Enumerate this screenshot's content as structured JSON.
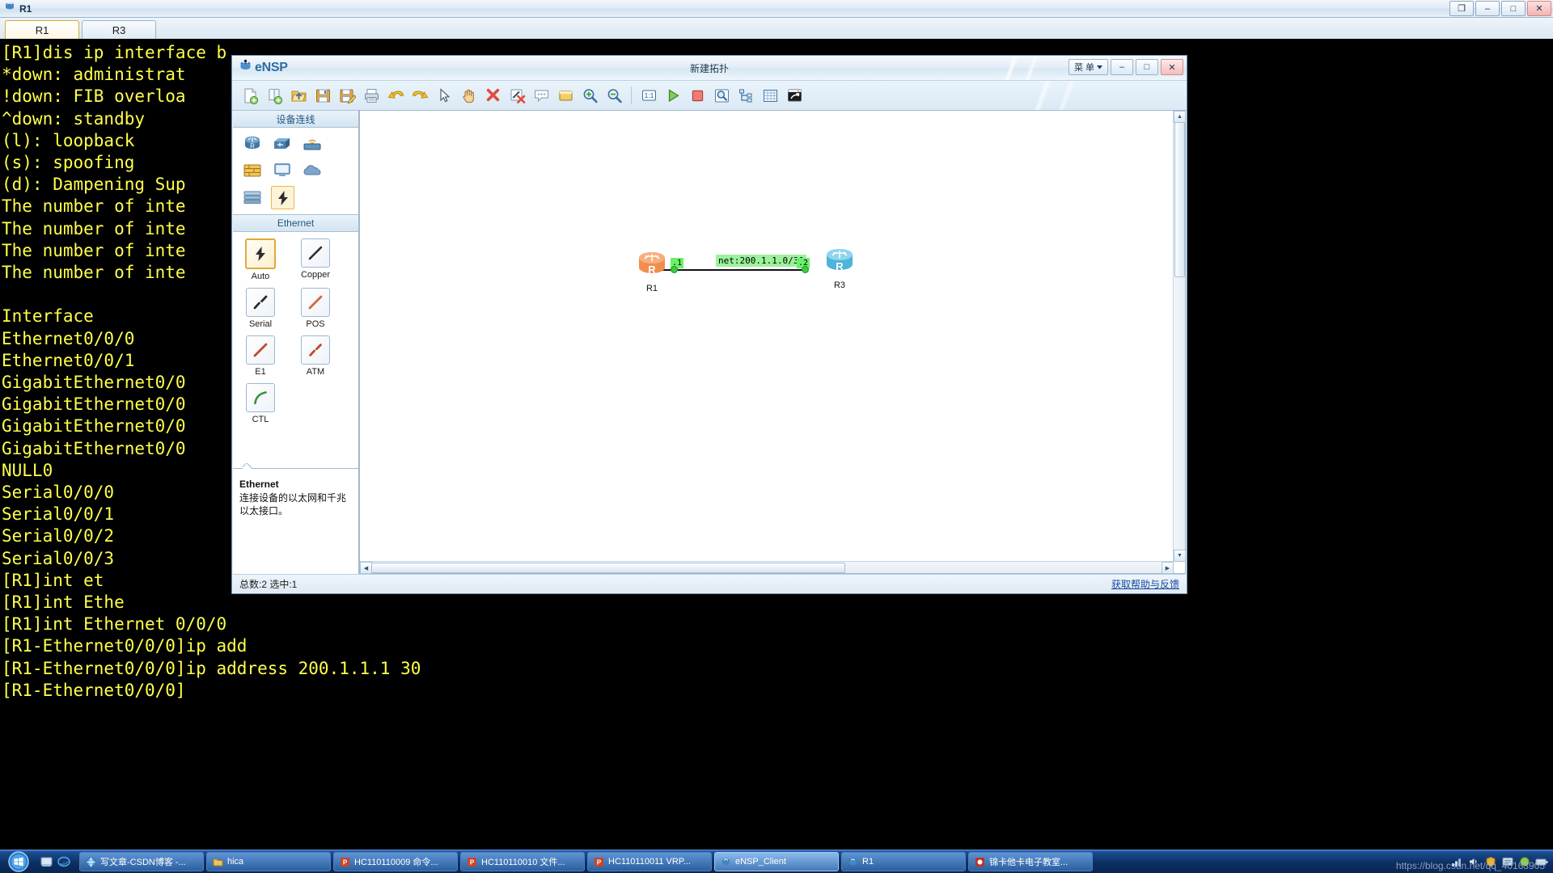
{
  "terminal": {
    "window_title": "R1",
    "icon": "ensp-device-icon",
    "window_buttons": [
      {
        "name": "restore-down",
        "glyph": "❐"
      },
      {
        "name": "minimize",
        "glyph": "–"
      },
      {
        "name": "maximize",
        "glyph": "□"
      },
      {
        "name": "close",
        "glyph": "✕"
      }
    ],
    "tabs": [
      {
        "label": "R1",
        "active": true
      },
      {
        "label": "R3",
        "active": false
      }
    ],
    "console_text": "[R1]dis ip interface b\n*down: administrat\n!down: FIB overloa\n^down: standby\n(l): loopback\n(s): spoofing\n(d): Dampening Sup\nThe number of inte\nThe number of inte\nThe number of inte\nThe number of inte\n\nInterface\nEthernet0/0/0\nEthernet0/0/1\nGigabitEthernet0/0\nGigabitEthernet0/0\nGigabitEthernet0/0\nGigabitEthernet0/0\nNULL0\nSerial0/0/0\nSerial0/0/1\nSerial0/0/2\nSerial0/0/3\n[R1]int et\n[R1]int Ethe\n[R1]int Ethernet 0/0/0\n[R1-Ethernet0/0/0]ip add\n[R1-Ethernet0/0/0]ip address 200.1.1.1 30\n[R1-Ethernet0/0/0]",
    "fg_color": "#ffff4d",
    "bg_color": "#000000"
  },
  "ensp": {
    "app_name": "eNSP",
    "doc_title": "新建拓扑",
    "menu_label": "菜 单",
    "window_buttons": [
      {
        "name": "minimize",
        "glyph": "–"
      },
      {
        "name": "maximize",
        "glyph": "□"
      },
      {
        "name": "close",
        "glyph": "✕"
      }
    ],
    "toolbar": [
      {
        "name": "new-topology-icon"
      },
      {
        "name": "new-from-template-icon"
      },
      {
        "name": "open-file-icon"
      },
      {
        "name": "save-icon"
      },
      {
        "name": "save-as-icon"
      },
      {
        "name": "print-icon"
      },
      {
        "name": "undo-icon"
      },
      {
        "name": "redo-icon"
      },
      {
        "name": "select-pointer-icon"
      },
      {
        "name": "pan-hand-icon"
      },
      {
        "name": "delete-icon"
      },
      {
        "name": "delete-link-icon"
      },
      {
        "name": "add-note-icon"
      },
      {
        "name": "add-shape-icon"
      },
      {
        "name": "zoom-in-icon"
      },
      {
        "name": "zoom-out-icon"
      },
      {
        "name": "zoom-actual-size-icon"
      },
      {
        "name": "start-all-devices-icon"
      },
      {
        "name": "stop-all-devices-icon"
      },
      {
        "name": "packet-capture-icon"
      },
      {
        "name": "topology-tree-icon"
      },
      {
        "name": "grid-icon"
      },
      {
        "name": "restore-window-icon"
      }
    ],
    "device_panel": {
      "title": "设备连线",
      "items": [
        {
          "name": "router-category-icon",
          "selected": false
        },
        {
          "name": "switch-category-icon",
          "selected": false
        },
        {
          "name": "wlan-category-icon",
          "selected": false
        },
        {
          "name": "firewall-category-icon",
          "selected": false
        },
        {
          "name": "endpoint-category-icon",
          "selected": false
        },
        {
          "name": "cloud-category-icon",
          "selected": false
        },
        {
          "name": "other-device-category-icon",
          "selected": false
        },
        {
          "name": "connection-category-icon",
          "selected": true
        }
      ]
    },
    "connection_panel": {
      "title": "Ethernet",
      "items": [
        {
          "label": "Auto",
          "icon": "auto-link-icon",
          "selected": true
        },
        {
          "label": "Copper",
          "icon": "copper-link-icon",
          "selected": false
        },
        {
          "label": "Serial",
          "icon": "serial-link-icon",
          "selected": false
        },
        {
          "label": "POS",
          "icon": "pos-link-icon",
          "selected": false
        },
        {
          "label": "E1",
          "icon": "e1-link-icon",
          "selected": false
        },
        {
          "label": "ATM",
          "icon": "atm-link-icon",
          "selected": false
        },
        {
          "label": "CTL",
          "icon": "ctl-link-icon",
          "selected": false
        }
      ]
    },
    "description": {
      "title": "Ethernet",
      "text": "连接设备的以太网和千兆以太接口。"
    },
    "topology": {
      "nodes": [
        {
          "name": "router-r1",
          "label": "R1",
          "type": "router",
          "color": "#f5914e"
        },
        {
          "name": "router-r3",
          "label": "R3",
          "type": "router",
          "color": "#5fbfe0"
        }
      ],
      "link": {
        "network_label": "net:200.1.1.0/30",
        "left_port_label": ".1",
        "right_port_label": ".2",
        "left_status_color": "#3ec93e",
        "right_status_color": "#3ec93e"
      }
    },
    "status": {
      "left": "总数:2 选中:1",
      "right": "获取帮助与反馈"
    }
  },
  "taskbar": {
    "start_label": "start",
    "quick_launch": [
      {
        "name": "show-desktop-icon"
      },
      {
        "name": "internet-explorer-icon"
      }
    ],
    "tasks": [
      {
        "label": "写文章-CSDN博客 -...",
        "icon": "browser-icon",
        "active": false
      },
      {
        "label": "hica",
        "icon": "folder-icon",
        "active": false
      },
      {
        "label": "HC110110009 命令...",
        "icon": "powerpoint-icon",
        "active": false
      },
      {
        "label": "HC110110010 文件...",
        "icon": "powerpoint-icon",
        "active": false
      },
      {
        "label": "HC110110011 VRP...",
        "icon": "powerpoint-icon",
        "active": false
      },
      {
        "label": "eNSP_Client",
        "icon": "ensp-icon",
        "active": true
      },
      {
        "label": "R1",
        "icon": "ensp-device-icon",
        "active": false
      },
      {
        "label": "锦卡他卡电子教室...",
        "icon": "app-icon",
        "active": false
      }
    ],
    "tray": [
      {
        "name": "network-icon"
      },
      {
        "name": "volume-icon"
      },
      {
        "name": "shield-icon"
      },
      {
        "name": "input-method-icon"
      },
      {
        "name": "app-tray-icon"
      },
      {
        "name": "battery-icon"
      }
    ]
  },
  "watermark": "https://blog.csdn.net/qq_40163905"
}
